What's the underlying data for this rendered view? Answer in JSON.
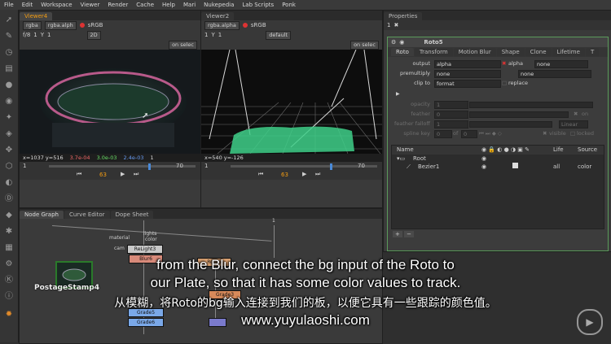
{
  "menubar": [
    "File",
    "Edit",
    "Workspace",
    "Viewer",
    "Render",
    "Cache",
    "Help",
    "Mari",
    "Nukepedia",
    "Lab Scripts",
    "Ponk"
  ],
  "viewer1": {
    "tab": "Viewer4",
    "channels": "rgba",
    "layer": "rgba.alph",
    "colorspace": "sRGB",
    "fstop": "f/8",
    "frame": "1",
    "y_label": "Y",
    "y_val": "1",
    "mode2d": "2D",
    "onselect": "on selec",
    "coords": "x=1037 y=516",
    "r": "3.7e-04",
    "g": "3.0e-03",
    "b": "2.4e-03",
    "a": "1",
    "frame_current": "63",
    "frame_end": "70",
    "frame_start": "1"
  },
  "viewer2": {
    "tab": "Viewer2",
    "channels": "rgba.alpha",
    "colorspace": "sRGB",
    "frame": "1",
    "y_label": "Y",
    "y_val": "1",
    "mode": "default",
    "onselect": "on selec",
    "coords": "x=540 y=-126",
    "frame_current": "63",
    "frame_end": "70",
    "frame_start": "1"
  },
  "properties": {
    "title": "Properties",
    "node_name": "Roto5",
    "tabs": [
      "Roto",
      "Transform",
      "Motion Blur",
      "Shape",
      "Clone",
      "Lifetime",
      "T"
    ],
    "output_label": "output",
    "output_val": "alpha",
    "output_check": "alpha",
    "output_none": "none",
    "premultiply_label": "premultiply",
    "premultiply_val": "none",
    "premultiply_none": "none",
    "clipto_label": "clip to",
    "clipto_val": "format",
    "replace": "replace",
    "opacity_label": "opacity",
    "opacity_val": "1",
    "feather_label": "feather",
    "feather_val": "0",
    "feather_on": "on",
    "falloff_label": "feather falloff",
    "falloff_val": "1",
    "falloff_type": "Linear",
    "splinekey_label": "spline key",
    "splinekey_val": "0",
    "splinekey_of": "of",
    "splinekey_total": "0",
    "visible": "visible",
    "locked": "locked",
    "tree_headers": [
      "Name",
      "Life",
      "Source"
    ],
    "tree_root": "Root",
    "tree_bezier": "Bezier1",
    "bezier_life": "all",
    "bezier_source": "color"
  },
  "nodegraph": {
    "tabs": [
      "Node Graph",
      "Curve Editor",
      "Dope Sheet"
    ],
    "label_material": "material",
    "label_cam": "cam",
    "label_lights": "lights",
    "label_color": "color",
    "label_one": "1",
    "nodes": [
      "ReLight3",
      "Blur6",
      "Roto5",
      "Grade5",
      "Grade6",
      "Grade3"
    ],
    "postage": "PostageStamp4"
  },
  "subtitles": {
    "en_line1": "from the Blur, connect the bg input of the Roto to",
    "en_line2": "our Plate, so that it has some color values to track.",
    "cn_line": "从模糊，将Roto的bg输入连接到我们的板，以便它具有一些跟踪的颜色值。",
    "watermark": "www.yuyulaoshi.com"
  }
}
